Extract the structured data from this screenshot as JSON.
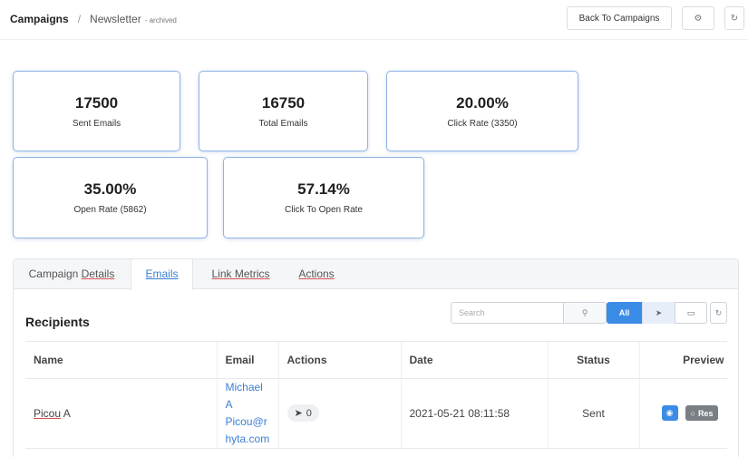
{
  "breadcrumb": {
    "root": "Campaigns",
    "separator": "/",
    "current": "Newsletter",
    "badge": "- archived"
  },
  "header": {
    "back_label": "Back To Campaigns",
    "gear_icon": "⚙",
    "refresh_icon": "↻"
  },
  "stats": [
    {
      "value": "17500",
      "label": "Sent Emails"
    },
    {
      "value": "16750",
      "label": "Total Emails"
    },
    {
      "value": "20.00%",
      "label": "Click Rate (3350)"
    },
    {
      "value": "35.00%",
      "label": "Open Rate (5862)"
    },
    {
      "value": "57.14%",
      "label": "Click To Open Rate"
    }
  ],
  "tabs": [
    {
      "prefix": "Campaign ",
      "underlined": "Details",
      "active": false
    },
    {
      "prefix": "",
      "underlined": "Emails",
      "active": true
    },
    {
      "prefix": "",
      "underlined": "Link Metrics",
      "active": false
    },
    {
      "prefix": "",
      "underlined": "Actions",
      "active": false
    }
  ],
  "recipients": {
    "title": "Recipients",
    "search_placeholder": "Search",
    "search_icon": "⚲",
    "filter_all": "All",
    "filter_sent_icon": "➤",
    "filter_folder_icon": "▭",
    "refresh_icon": "↻"
  },
  "table": {
    "columns": [
      "Name",
      "Email",
      "Actions",
      "Date",
      "Status",
      "Preview"
    ],
    "rows": [
      {
        "name_underlined": "Picou",
        "name_rest": " A",
        "email": "MichaelA Picou@r hyta.com",
        "email_lines": [
          "MichaelA",
          "Picou@r",
          "hyta.com"
        ],
        "action_icon": "➤",
        "action_count": "0",
        "date": "2021-05-21 08:11:58",
        "status": "Sent",
        "preview_eye_icon": "◉",
        "preview_res_icon": "○",
        "preview_res_label": "Res"
      }
    ]
  }
}
